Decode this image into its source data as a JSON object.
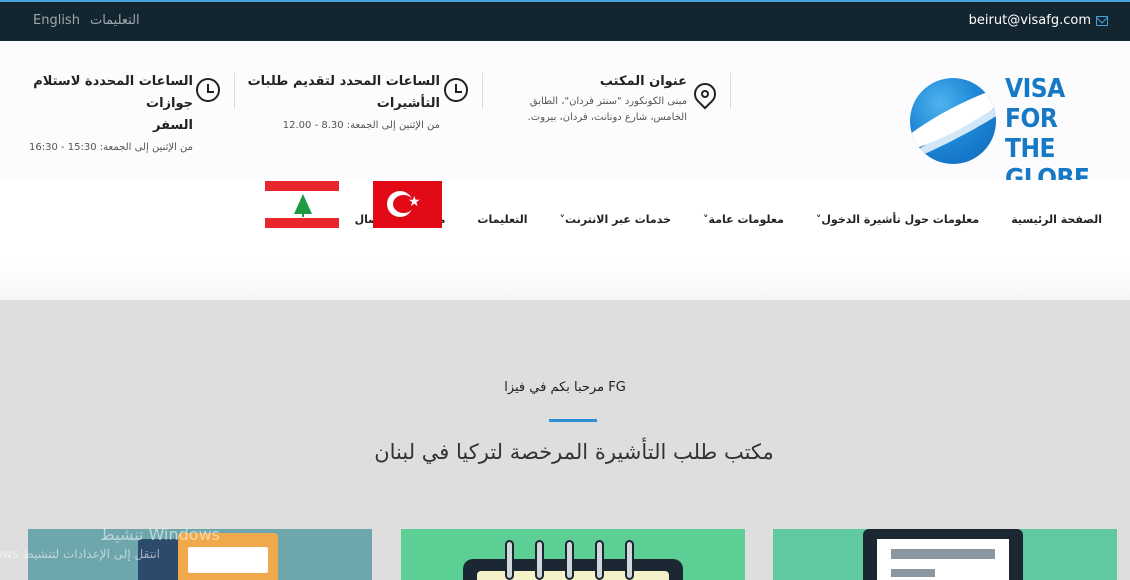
{
  "topbar": {
    "email": "beirut@visafg.com",
    "lang_english": "English",
    "instructions": "التعليمات"
  },
  "logo": {
    "line1": "VISA",
    "line2": "FOR THE",
    "line3": "GLOBE",
    "brand_color": "#1679c6"
  },
  "info": {
    "office": {
      "title": "عنوان المكتب",
      "line1": "مبنى الكونكورد \"سنتر فردان\"، الطابق",
      "line2": "الخامس، شارع دونانت، فردان، بيروت."
    },
    "submission": {
      "title_line1": "الساعات المحدد لتقديم طلبات",
      "title_line2": "التأشيرات",
      "sub": "من الإثنين إلى الجمعة: 8.30 - 12.00"
    },
    "collection": {
      "title_line1": "الساعات المحددة لاستلام جوازات",
      "title_line2": "السفر",
      "sub": "من الإثنين إلى الجمعة: 15:30 - 16:30"
    }
  },
  "nav": {
    "items": [
      {
        "label": "الصفحة الرئيسية"
      },
      {
        "label": "معلومات حول تأشيرة الدخول˅"
      },
      {
        "label": "معلومات عامة˅"
      },
      {
        "label": "خدمات عبر الانترنت˅"
      },
      {
        "label": "التعليمات"
      },
      {
        "label": "معلومات الاتصال"
      }
    ]
  },
  "main": {
    "welcome": "مرحبا بكم في فيزا FG",
    "title": "مكتب طلب التأشيرة المرخصة لتركيا في لبنان",
    "accent_color": "#2f8fd3"
  },
  "watermark": {
    "line1": "Windows تنشيط",
    "line2": "انتقل إلى الإعدادات لتنشيط Windows"
  }
}
